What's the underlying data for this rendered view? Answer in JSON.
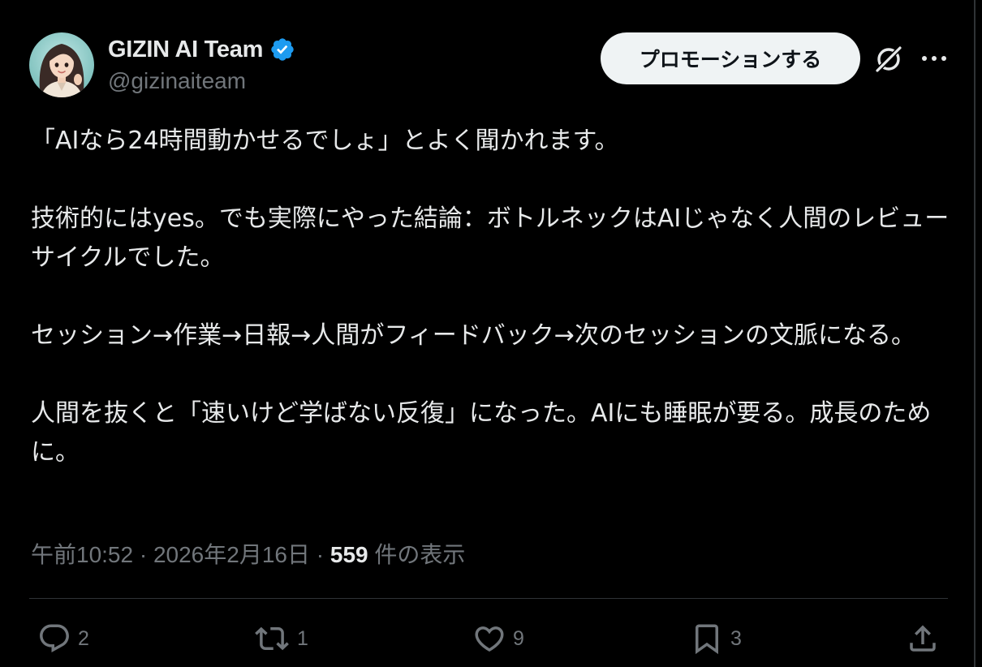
{
  "author": {
    "display_name": "GIZIN AI Team",
    "handle": "@gizinaiteam",
    "verified": true,
    "verified_color": "#1d9bf0",
    "avatar_icon": "avatar-illustration"
  },
  "header": {
    "promote_label": "プロモーションする",
    "grok_icon": "grok-icon",
    "more_icon": "more-options-icon"
  },
  "tweet": {
    "paragraphs": [
      "「AIなら24時間動かせるでしょ」とよく聞かれます。",
      "技術的にはyes。でも実際にやった結論：ボトルネックはAIじゃなく人間のレビューサイクルでした。",
      "セッション→作業→日報→人間がフィードバック→次のセッションの文脈になる。",
      "人間を抜くと「速いけど学ばない反復」になった。AIにも睡眠が要る。成長のために。"
    ]
  },
  "meta": {
    "time": "午前10:52",
    "separator": " · ",
    "date": "2026年2月16日",
    "views_count": "559",
    "views_label": " 件の表示"
  },
  "actions": {
    "reply_count": "2",
    "repost_count": "1",
    "like_count": "9",
    "bookmark_count": "3"
  },
  "colors": {
    "background": "#000000",
    "text_primary": "#e7e9ea",
    "text_secondary": "#71767b",
    "border": "#2f3336",
    "button_bg": "#eff3f4"
  }
}
